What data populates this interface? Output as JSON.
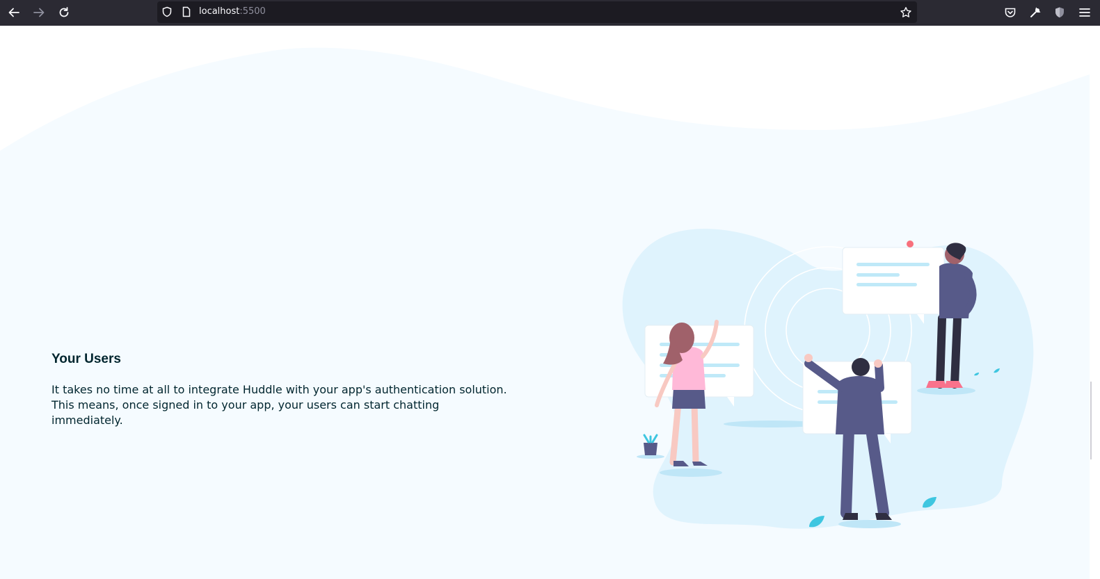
{
  "browser": {
    "url_host": "localhost",
    "url_port": ":5500",
    "icons": [
      "back-arrow-icon",
      "forward-arrow-icon",
      "reload-icon",
      "shield-icon",
      "page-icon",
      "star-icon",
      "pocket-icon",
      "wrench-icon",
      "extension-shield-icon",
      "menu-icon"
    ]
  },
  "section": {
    "title": "Your Users",
    "description": "It takes no time at all to integrate Huddle with your app's authentication solution. This means, once signed in to your app, your users can start chatting immediately."
  },
  "colors": {
    "toolbar": "#2b2a33",
    "page_bg": "#f5fbff",
    "text": "#00252e",
    "blob": "#dff3fd",
    "accent": "#3ec6e0"
  }
}
